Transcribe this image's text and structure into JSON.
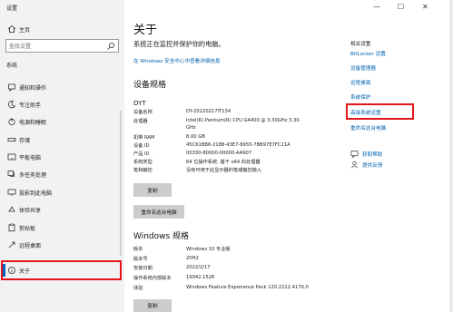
{
  "window": {
    "title": "设置",
    "minimize": "—",
    "maximize": "☐",
    "close": "✕"
  },
  "sidebar": {
    "home": "主页",
    "search_placeholder": "查找设置",
    "section": "系统",
    "items": [
      {
        "label": "通知和操作",
        "icon": "message-icon"
      },
      {
        "label": "专注助手",
        "icon": "moon-icon"
      },
      {
        "label": "电源和睡眠",
        "icon": "power-icon"
      },
      {
        "label": "存储",
        "icon": "storage-icon"
      },
      {
        "label": "平板电脑",
        "icon": "tablet-icon"
      },
      {
        "label": "多任务处理",
        "icon": "multitask-icon"
      },
      {
        "label": "投影到此电脑",
        "icon": "projector-icon"
      },
      {
        "label": "体验共享",
        "icon": "share-icon"
      },
      {
        "label": "剪贴板",
        "icon": "clipboard-icon"
      },
      {
        "label": "远程桌面",
        "icon": "remote-icon"
      },
      {
        "label": "关于",
        "icon": "info-icon"
      }
    ]
  },
  "main": {
    "title": "关于",
    "subtitle": "系统正在监控并保护你的电脑。",
    "security_link": "在 Windows 安全中心中查看详细信息",
    "device_spec_title": "设备规格",
    "device_name": "DYT",
    "device_specs": [
      {
        "label": "设备名称",
        "value": "DY-20220217IT134"
      },
      {
        "label": "处理器",
        "value": "Intel(R) Pentium(R) CPU G4400 @ 3.30GHz   3.30",
        "value2": "GHz"
      },
      {
        "label": "机带 RAM",
        "value": "8.00 GB"
      },
      {
        "label": "设备 ID",
        "value": "45C61BB6-2188-43E7-8955-7BB97E7FC21A"
      },
      {
        "label": "产品 ID",
        "value": "00330-80000-00000-AA907"
      },
      {
        "label": "系统类型",
        "value": "64 位操作系统, 基于 x64 的处理器"
      },
      {
        "label": "笔和触控",
        "value": "没有可用于此显示器的笔或触控输入"
      }
    ],
    "copy_label": "复制",
    "rename_label": "重命名这台电脑",
    "win_spec_title": "Windows 规格",
    "win_specs": [
      {
        "label": "版本",
        "value": "Windows 10 专业版"
      },
      {
        "label": "版本号",
        "value": "20H2"
      },
      {
        "label": "安装日期",
        "value": "2022/2/17"
      },
      {
        "label": "操作系统内部版本",
        "value": "19042.1526"
      },
      {
        "label": "体验",
        "value": "Windows Feature Experience Pack 120.2212.4170.0"
      }
    ]
  },
  "related": {
    "title": "相关设置",
    "links": [
      "BitLocker 设置",
      "设备管理器",
      "远程桌面",
      "系统保护",
      "高级系统设置",
      "重命名这台电脑"
    ],
    "help": [
      "获取帮助",
      "提供反馈"
    ]
  },
  "colors": {
    "accent": "#0067c0",
    "highlight": "#e2141c",
    "link": "#0063b1"
  }
}
